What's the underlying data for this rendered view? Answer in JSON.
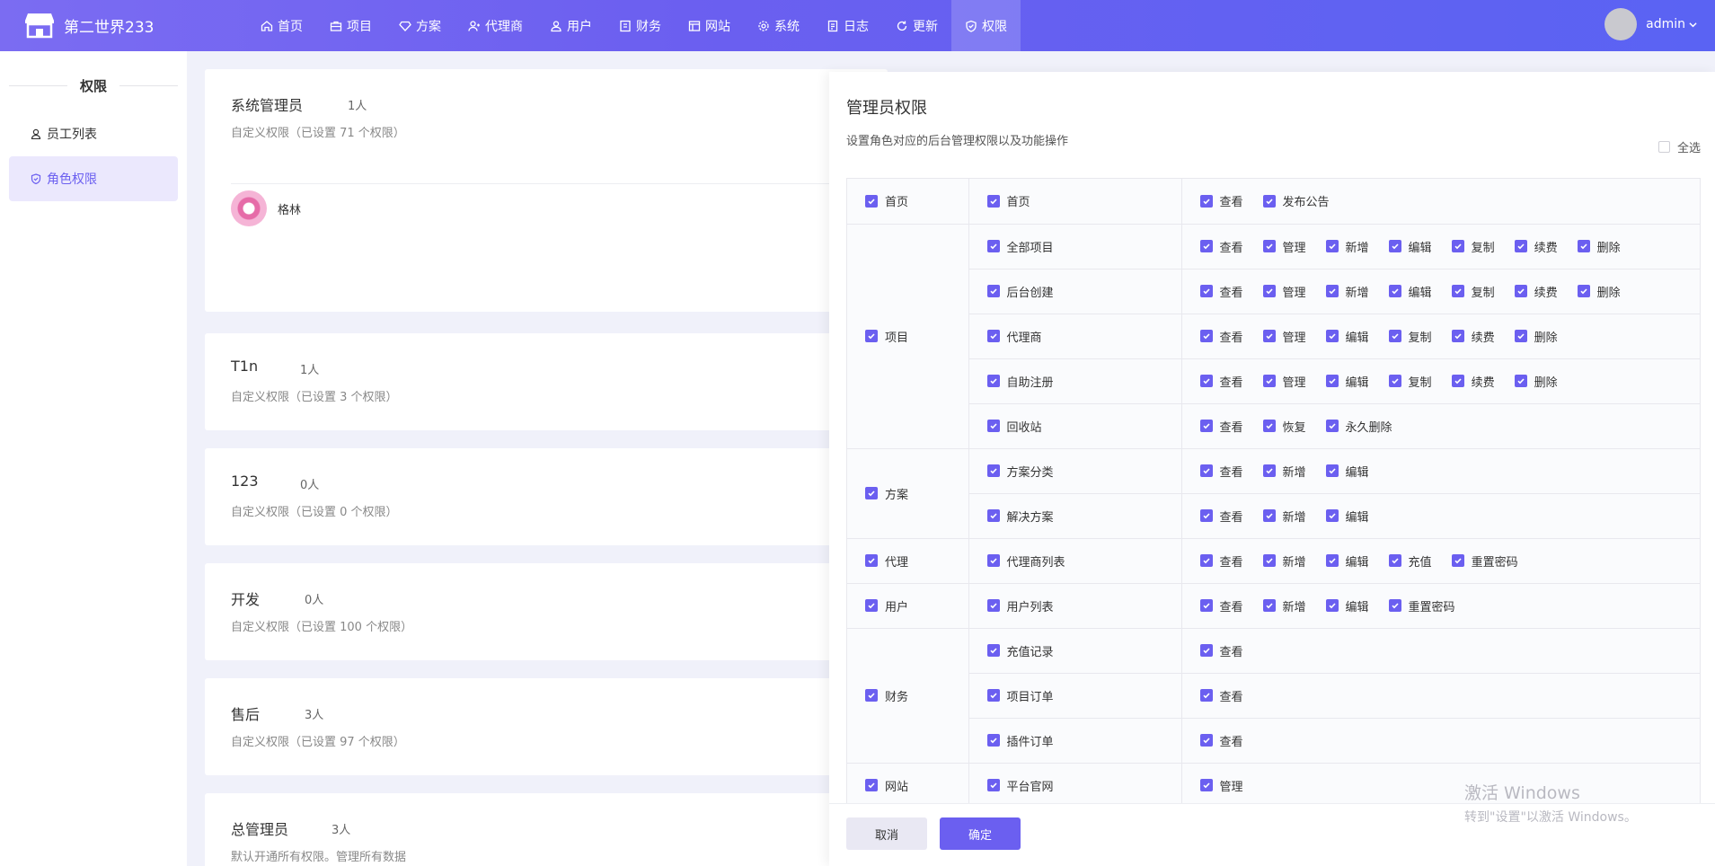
{
  "app": {
    "name": "第二世界233",
    "user": "admin"
  },
  "nav": [
    {
      "label": "首页",
      "icon": "home-icon"
    },
    {
      "label": "项目",
      "icon": "briefcase-icon"
    },
    {
      "label": "方案",
      "icon": "diamond-icon"
    },
    {
      "label": "代理商",
      "icon": "agent-icon"
    },
    {
      "label": "用户",
      "icon": "users-icon"
    },
    {
      "label": "财务",
      "icon": "finance-icon"
    },
    {
      "label": "网站",
      "icon": "website-icon"
    },
    {
      "label": "系统",
      "icon": "gear-icon"
    },
    {
      "label": "日志",
      "icon": "log-icon"
    },
    {
      "label": "更新",
      "icon": "refresh-icon"
    },
    {
      "label": "权限",
      "icon": "shield-icon"
    }
  ],
  "sidebar": {
    "title": "权限",
    "items": [
      {
        "label": "员工列表",
        "icon": "user-icon"
      },
      {
        "label": "角色权限",
        "icon": "shield-icon"
      }
    ]
  },
  "roles": [
    {
      "name": "系统管理员",
      "count": "1人",
      "desc": "自定义权限（已设置 71 个权限）",
      "member": "格林"
    },
    {
      "name": "T1n",
      "count": "1人",
      "desc": "自定义权限（已设置 3 个权限）"
    },
    {
      "name": "123",
      "count": "0人",
      "desc": "自定义权限（已设置 0 个权限）"
    },
    {
      "name": "开发",
      "count": "0人",
      "desc": "自定义权限（已设置 100 个权限）"
    },
    {
      "name": "售后",
      "count": "3人",
      "desc": "自定义权限（已设置 97 个权限）"
    },
    {
      "name": "总管理员",
      "count": "3人",
      "desc": "默认开通所有权限。管理所有数据"
    }
  ],
  "panel": {
    "title": "管理员权限",
    "subtitle": "设置角色对应的后台管理权限以及功能操作",
    "select_all": "全选",
    "cancel": "取消",
    "confirm": "确定",
    "groups": [
      {
        "name": "首页",
        "rows": [
          {
            "module": "首页",
            "actions": [
              "查看",
              "发布公告"
            ]
          }
        ]
      },
      {
        "name": "项目",
        "rows": [
          {
            "module": "全部项目",
            "actions": [
              "查看",
              "管理",
              "新增",
              "编辑",
              "复制",
              "续费",
              "删除"
            ]
          },
          {
            "module": "后台创建",
            "actions": [
              "查看",
              "管理",
              "新增",
              "编辑",
              "复制",
              "续费",
              "删除"
            ]
          },
          {
            "module": "代理商",
            "actions": [
              "查看",
              "管理",
              "编辑",
              "复制",
              "续费",
              "删除"
            ]
          },
          {
            "module": "自助注册",
            "actions": [
              "查看",
              "管理",
              "编辑",
              "复制",
              "续费",
              "删除"
            ]
          },
          {
            "module": "回收站",
            "actions": [
              "查看",
              "恢复",
              "永久删除"
            ]
          }
        ]
      },
      {
        "name": "方案",
        "rows": [
          {
            "module": "方案分类",
            "actions": [
              "查看",
              "新增",
              "编辑"
            ]
          },
          {
            "module": "解决方案",
            "actions": [
              "查看",
              "新增",
              "编辑"
            ]
          }
        ]
      },
      {
        "name": "代理",
        "rows": [
          {
            "module": "代理商列表",
            "actions": [
              "查看",
              "新增",
              "编辑",
              "充值",
              "重置密码"
            ]
          }
        ]
      },
      {
        "name": "用户",
        "rows": [
          {
            "module": "用户列表",
            "actions": [
              "查看",
              "新增",
              "编辑",
              "重置密码"
            ]
          }
        ]
      },
      {
        "name": "财务",
        "rows": [
          {
            "module": "充值记录",
            "actions": [
              "查看"
            ]
          },
          {
            "module": "项目订单",
            "actions": [
              "查看"
            ]
          },
          {
            "module": "插件订单",
            "actions": [
              "查看"
            ]
          }
        ]
      },
      {
        "name": "网站",
        "rows": [
          {
            "module": "平台官网",
            "actions": [
              "管理"
            ]
          }
        ]
      }
    ]
  },
  "watermark": {
    "line1": "激活 Windows",
    "line2": "转到\"设置\"以激活 Windows。"
  },
  "colors": {
    "accent": "#6b5ff0",
    "header_start": "#7b6cf2",
    "header_end": "#5a63f3"
  }
}
